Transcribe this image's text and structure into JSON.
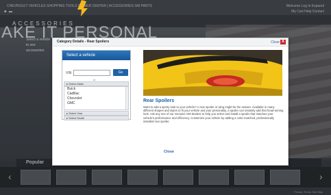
{
  "background": {
    "topnav": "CHEVROLET   VEHICLES   SHOPPING TOOLS   OWNER CENTER   |   ACCESSORIES   GM PARTS",
    "top_right": "Welcome  Log In  Espanol",
    "top_right_2": "My Cart  Help  Contact",
    "brand_label": "ACCESSORIES",
    "hero_title": "AKE IT PERSONAL",
    "hero_text": "Select a vehicle to see accessories",
    "popular_label": "Popular",
    "bottom_text": "Privacy  Terms  Site Map"
  },
  "modal": {
    "title": "Category Details - Rear Spoilers",
    "close_link": "Close",
    "close_x": "X",
    "vehicle_panel": {
      "title": "Select a vehicle",
      "vin_label": "VIN",
      "vin_value": "",
      "go_button": "Go",
      "or_label": "or",
      "make_bar": "Select Make",
      "makes": [
        "Buick",
        "Cadillac",
        "Chevrolet",
        "GMC"
      ],
      "year_bar": "Select Year",
      "model_bar": "Select Model"
    },
    "product": {
      "title": "Rear Spoilers",
      "description": "Want to add a sporty look to your vehicle? A rear spoiler or wing might be the answer. Available in many different shapes and styles to fit your vehicle and your personality, a spoiler can instantly add that head-turning look. Ask any one of our Genuine GM dealers to help you select and install a spoiler that matches your vehicle's performance and efficiency. Customize your vehicle by adding a color-matched, professionally installed rear spoiler."
    },
    "close_button": "Close"
  },
  "colors": {
    "accent_blue": "#1d62a6",
    "close_red": "#c9242b",
    "pointer_arrow": "#f4b71e"
  }
}
